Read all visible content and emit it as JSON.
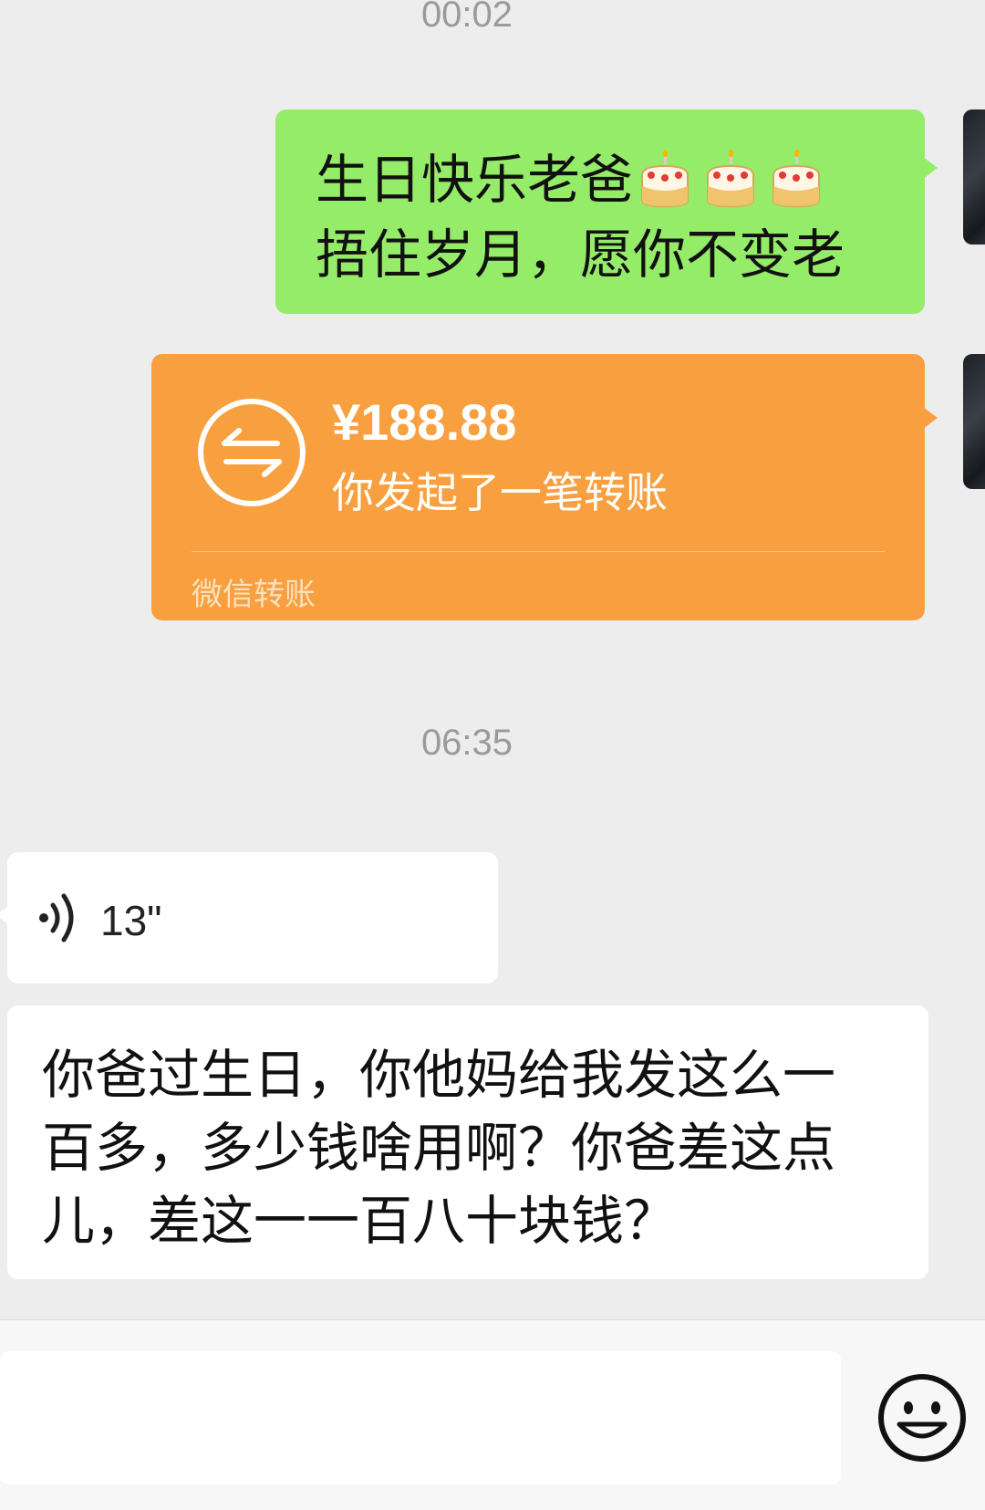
{
  "timestamps": [
    "00:02",
    "06:35"
  ],
  "messages": {
    "sent_text": {
      "line1": "生日快乐老爸",
      "line2": "捂住岁月，愿你不变老",
      "emoji_icons": [
        "cake-icon",
        "cake-icon",
        "cake-icon"
      ]
    },
    "transfer": {
      "amount": "¥188.88",
      "description": "你发起了一笔转账",
      "footer": "微信转账",
      "icon": "transfer-icon",
      "color": "#f8a040"
    },
    "voice": {
      "duration": "13\"",
      "icon": "voice-wave-icon"
    },
    "received_text": {
      "line1": "你爸过生日，你他妈给我发这么一",
      "line2": "百多，多少钱啥用啊？你爸差这点",
      "line3": "儿，差这一一百八十块钱？"
    }
  },
  "input": {
    "emoji_icon": "smiley-icon"
  },
  "colors": {
    "background": "#ededed",
    "sent_bubble": "#95ec69",
    "received_bubble": "#ffffff"
  }
}
